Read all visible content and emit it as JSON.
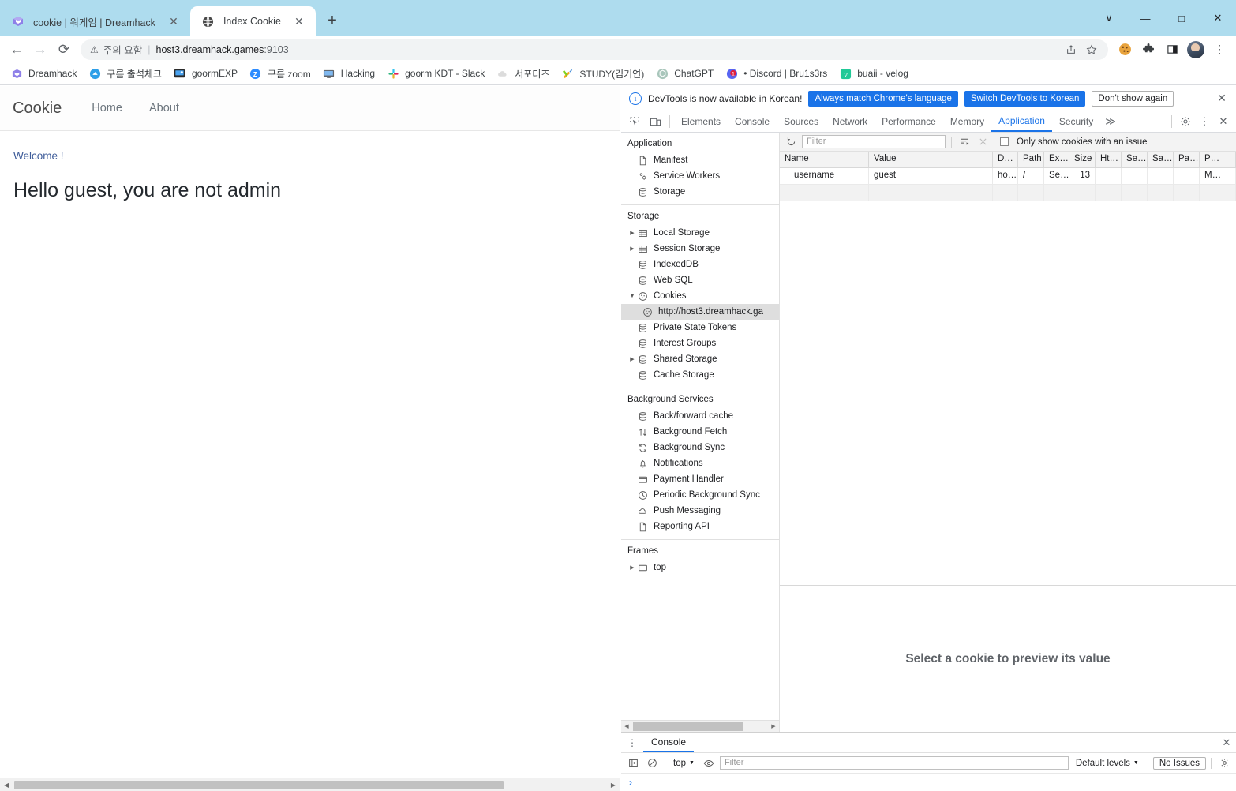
{
  "browser": {
    "tabs": [
      {
        "title": "cookie | 워게임 | Dreamhack",
        "favicon": "dreamhack-icon",
        "active": false,
        "close_label": "✕"
      },
      {
        "title": "Index Cookie",
        "favicon": "globe-icon",
        "active": true,
        "close_label": "✕"
      }
    ],
    "new_tab_label": "+",
    "window_controls": {
      "minimize_all": "∨",
      "minimize": "—",
      "maximize": "□",
      "close": "✕"
    },
    "nav": {
      "back": "←",
      "forward": "→",
      "reload": "⟳"
    },
    "omnibox": {
      "warning_icon": "⚠",
      "warning_text": "주의 요함",
      "separator": "|",
      "url": "host3.dreamhack.games",
      "port": ":9103",
      "share_icon": "share-icon",
      "bookmark_icon": "star-icon"
    },
    "extensions": [
      {
        "name": "cookie-editor-extension-icon",
        "glyph": "🍪"
      },
      {
        "name": "extensions-puzzle-icon",
        "glyph": "🧩"
      },
      {
        "name": "side-panel-icon",
        "glyph": "▣"
      }
    ],
    "profile": "avatar",
    "menu_icon": "⋮",
    "bookmarks": [
      {
        "label": "Dreamhack",
        "icon": "dreamhack-icon"
      },
      {
        "label": "구름 출석체크",
        "icon": "cloud-icon"
      },
      {
        "label": "goormEXP",
        "icon": "goorm-icon"
      },
      {
        "label": "구름 zoom",
        "icon": "zoom-icon"
      },
      {
        "label": "Hacking",
        "icon": "monitor-icon"
      },
      {
        "label": "goorm KDT - Slack",
        "icon": "slack-icon"
      },
      {
        "label": "서포터즈",
        "icon": "cloud-grey-icon"
      },
      {
        "label": "STUDY(김기연)",
        "icon": "tools-icon"
      },
      {
        "label": "ChatGPT",
        "icon": "chatgpt-icon"
      },
      {
        "label": "• Discord | Bru1s3rs",
        "icon": "discord-icon"
      },
      {
        "label": "buaii - velog",
        "icon": "velog-icon"
      }
    ]
  },
  "page": {
    "brand": "Cookie",
    "nav_links": [
      "Home",
      "About"
    ],
    "welcome": "Welcome !",
    "heading": "Hello guest, you are not admin"
  },
  "devtools": {
    "banner": {
      "icon": "info-icon",
      "message": "DevTools is now available in Korean!",
      "primary_button": "Always match Chrome's language",
      "secondary_button": "Switch DevTools to Korean",
      "dismiss_button": "Don't show again",
      "close": "✕"
    },
    "toolbar_icons": [
      {
        "name": "inspect-element-icon"
      },
      {
        "name": "device-toolbar-icon"
      }
    ],
    "tabs": [
      "Elements",
      "Console",
      "Sources",
      "Network",
      "Performance",
      "Memory",
      "Application",
      "Security"
    ],
    "selected_tab": "Application",
    "more_tabs": "≫",
    "settings_icon": "gear-icon",
    "kebab_icon": "⋮",
    "close_icon": "✕",
    "sidebar": {
      "sections": [
        {
          "title": "Application",
          "items": [
            {
              "label": "Manifest",
              "icon": "document-icon",
              "twisty": "",
              "indent": false
            },
            {
              "label": "Service Workers",
              "icon": "gears-icon",
              "twisty": "",
              "indent": false
            },
            {
              "label": "Storage",
              "icon": "database-icon",
              "twisty": "",
              "indent": false
            }
          ]
        },
        {
          "title": "Storage",
          "items": [
            {
              "label": "Local Storage",
              "icon": "table-icon",
              "twisty": "▶",
              "indent": false
            },
            {
              "label": "Session Storage",
              "icon": "table-icon",
              "twisty": "▶",
              "indent": false
            },
            {
              "label": "IndexedDB",
              "icon": "database-icon",
              "twisty": "",
              "indent": false
            },
            {
              "label": "Web SQL",
              "icon": "database-icon",
              "twisty": "",
              "indent": false
            },
            {
              "label": "Cookies",
              "icon": "cookie-icon",
              "twisty": "▼",
              "indent": false
            },
            {
              "label": "http://host3.dreamhack.ga",
              "icon": "cookie-icon",
              "twisty": "",
              "indent": true,
              "selected": true
            },
            {
              "label": "Private State Tokens",
              "icon": "database-icon",
              "twisty": "",
              "indent": false
            },
            {
              "label": "Interest Groups",
              "icon": "database-icon",
              "twisty": "",
              "indent": false
            },
            {
              "label": "Shared Storage",
              "icon": "database-icon",
              "twisty": "▶",
              "indent": false
            },
            {
              "label": "Cache Storage",
              "icon": "database-icon",
              "twisty": "",
              "indent": false
            }
          ]
        },
        {
          "title": "Background Services",
          "items": [
            {
              "label": "Back/forward cache",
              "icon": "database-icon",
              "twisty": "",
              "indent": false
            },
            {
              "label": "Background Fetch",
              "icon": "arrows-updown-icon",
              "twisty": "",
              "indent": false
            },
            {
              "label": "Background Sync",
              "icon": "sync-icon",
              "twisty": "",
              "indent": false
            },
            {
              "label": "Notifications",
              "icon": "bell-icon",
              "twisty": "",
              "indent": false
            },
            {
              "label": "Payment Handler",
              "icon": "card-icon",
              "twisty": "",
              "indent": false
            },
            {
              "label": "Periodic Background Sync",
              "icon": "clock-icon",
              "twisty": "",
              "indent": false
            },
            {
              "label": "Push Messaging",
              "icon": "cloud-icon",
              "twisty": "",
              "indent": false
            },
            {
              "label": "Reporting API",
              "icon": "document-icon",
              "twisty": "",
              "indent": false
            }
          ]
        },
        {
          "title": "Frames",
          "items": [
            {
              "label": "top",
              "icon": "frame-icon",
              "twisty": "▶",
              "indent": false
            }
          ]
        }
      ]
    },
    "cookies_panel": {
      "refresh_icon": "refresh-icon",
      "filter_placeholder": "Filter",
      "clear_filtered_icon": "clear-filtered-icon",
      "clear_all_icon": "clear-all-icon",
      "issue_checkbox_label": "Only show cookies with an issue",
      "issue_checkbox_checked": false,
      "columns": [
        "Name",
        "Value",
        "D…",
        "Path",
        "Ex…",
        "Size",
        "Ht…",
        "Se…",
        "Sa…",
        "Pa…",
        "P…"
      ],
      "rows": [
        {
          "Name": "username",
          "Value": "guest",
          "D": "ho…",
          "Path": "/",
          "Ex": "Se…",
          "Size": "13",
          "Ht": "",
          "Se": "",
          "Sa": "",
          "Pa": "",
          "P": "M…"
        }
      ],
      "preview_text": "Select a cookie to preview its value"
    },
    "drawer": {
      "kebab": "⋮",
      "tab": "Console",
      "close": "✕",
      "sidebar_icon": "console-sidebar-icon",
      "clear_icon": "clear-console-icon",
      "context": "top",
      "context_caret": "▼",
      "eye_icon": "live-expression-icon",
      "filter_placeholder": "Filter",
      "levels": "Default levels",
      "levels_caret": "▼",
      "issues": "No Issues",
      "settings_icon": "gear-icon",
      "prompt": "›"
    }
  },
  "colors": {
    "chrome_tabstrip": "#aedcee",
    "devtools_accent": "#1a73e8",
    "link": "#3f5d9a",
    "muted": "#5f6368"
  }
}
